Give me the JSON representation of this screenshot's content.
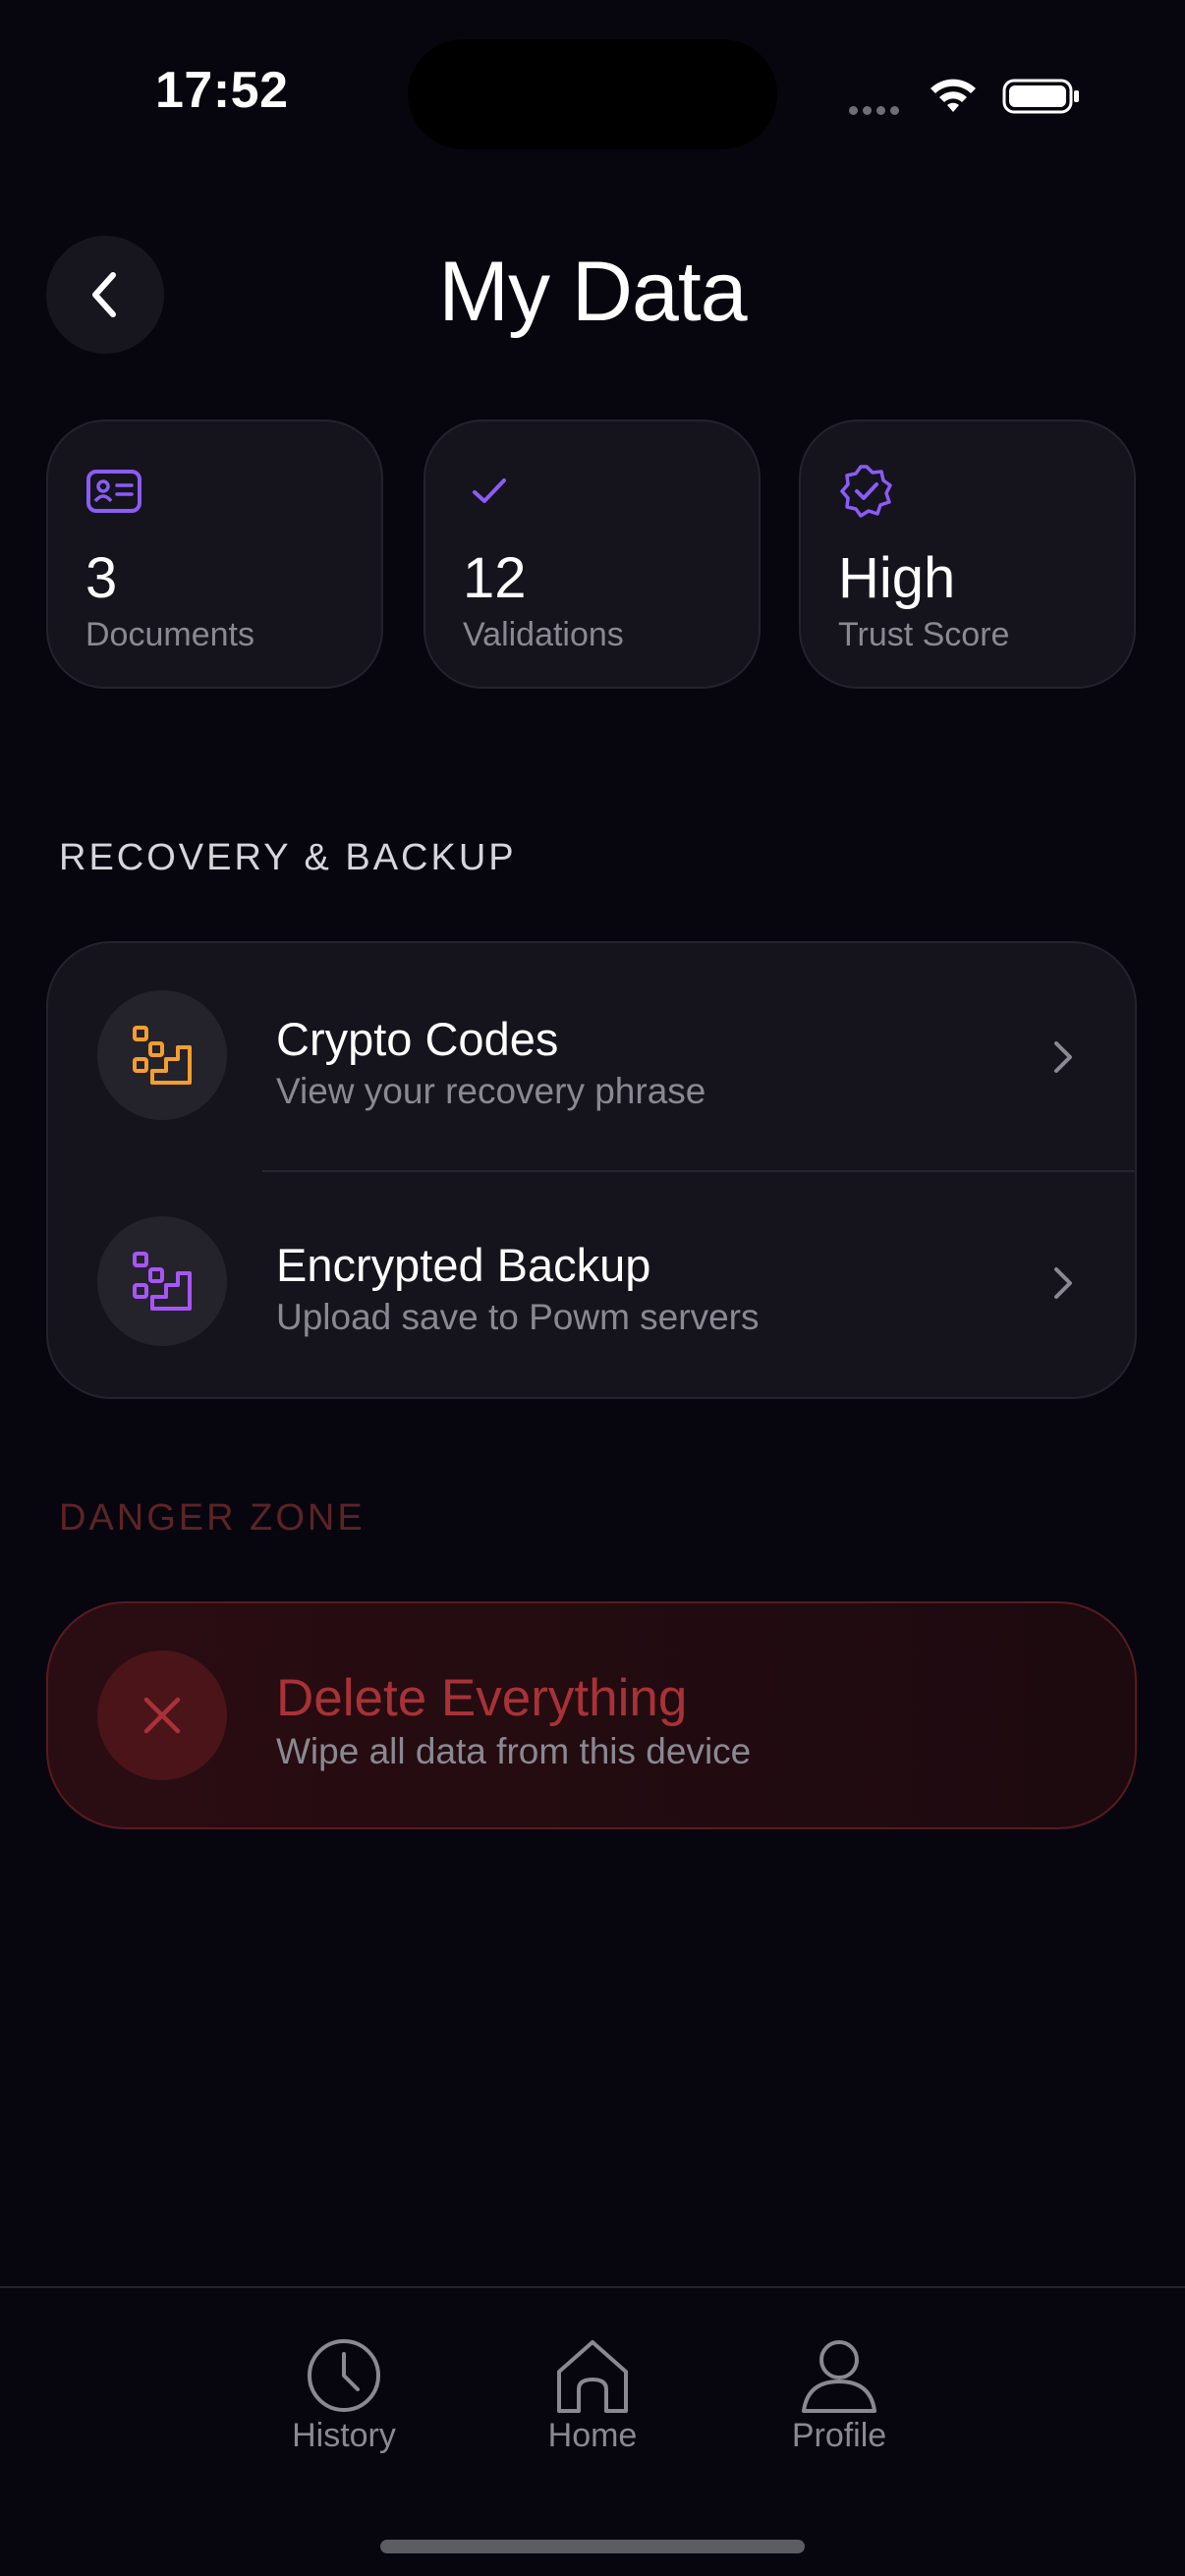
{
  "status_bar": {
    "time": "17:52"
  },
  "header": {
    "title": "My Data",
    "back_icon": "chevron-left-icon"
  },
  "stats": [
    {
      "icon": "id-card-icon",
      "value": "3",
      "label": "Documents",
      "icon_color": "#8b5cf6"
    },
    {
      "icon": "checkmark-icon",
      "value": "12",
      "label": "Validations",
      "icon_color": "#8b5cf6"
    },
    {
      "icon": "verified-badge-icon",
      "value": "High",
      "label": "Trust Score",
      "icon_color": "#8b5cf6"
    }
  ],
  "recovery": {
    "section_label": "RECOVERY & BACKUP",
    "items": [
      {
        "icon": "crypto-steps-icon",
        "icon_color": "#f59e2e",
        "title": "Crypto Codes",
        "subtitle": "View your recovery phrase"
      },
      {
        "icon": "backup-steps-icon",
        "icon_color": "#a855f7",
        "title": "Encrypted Backup",
        "subtitle": "Upload save to Powm servers"
      }
    ]
  },
  "danger": {
    "section_label": "DANGER ZONE",
    "title": "Delete Everything",
    "subtitle": "Wipe all data from this device",
    "icon": "close-icon",
    "accent_color": "#a83237"
  },
  "tabbar": {
    "tabs": [
      {
        "icon": "clock-icon",
        "label": "History"
      },
      {
        "icon": "home-icon",
        "label": "Home"
      },
      {
        "icon": "person-icon",
        "label": "Profile"
      }
    ]
  },
  "colors": {
    "background": "#07060f",
    "card": "#15141d",
    "muted_text": "#8a8992"
  }
}
